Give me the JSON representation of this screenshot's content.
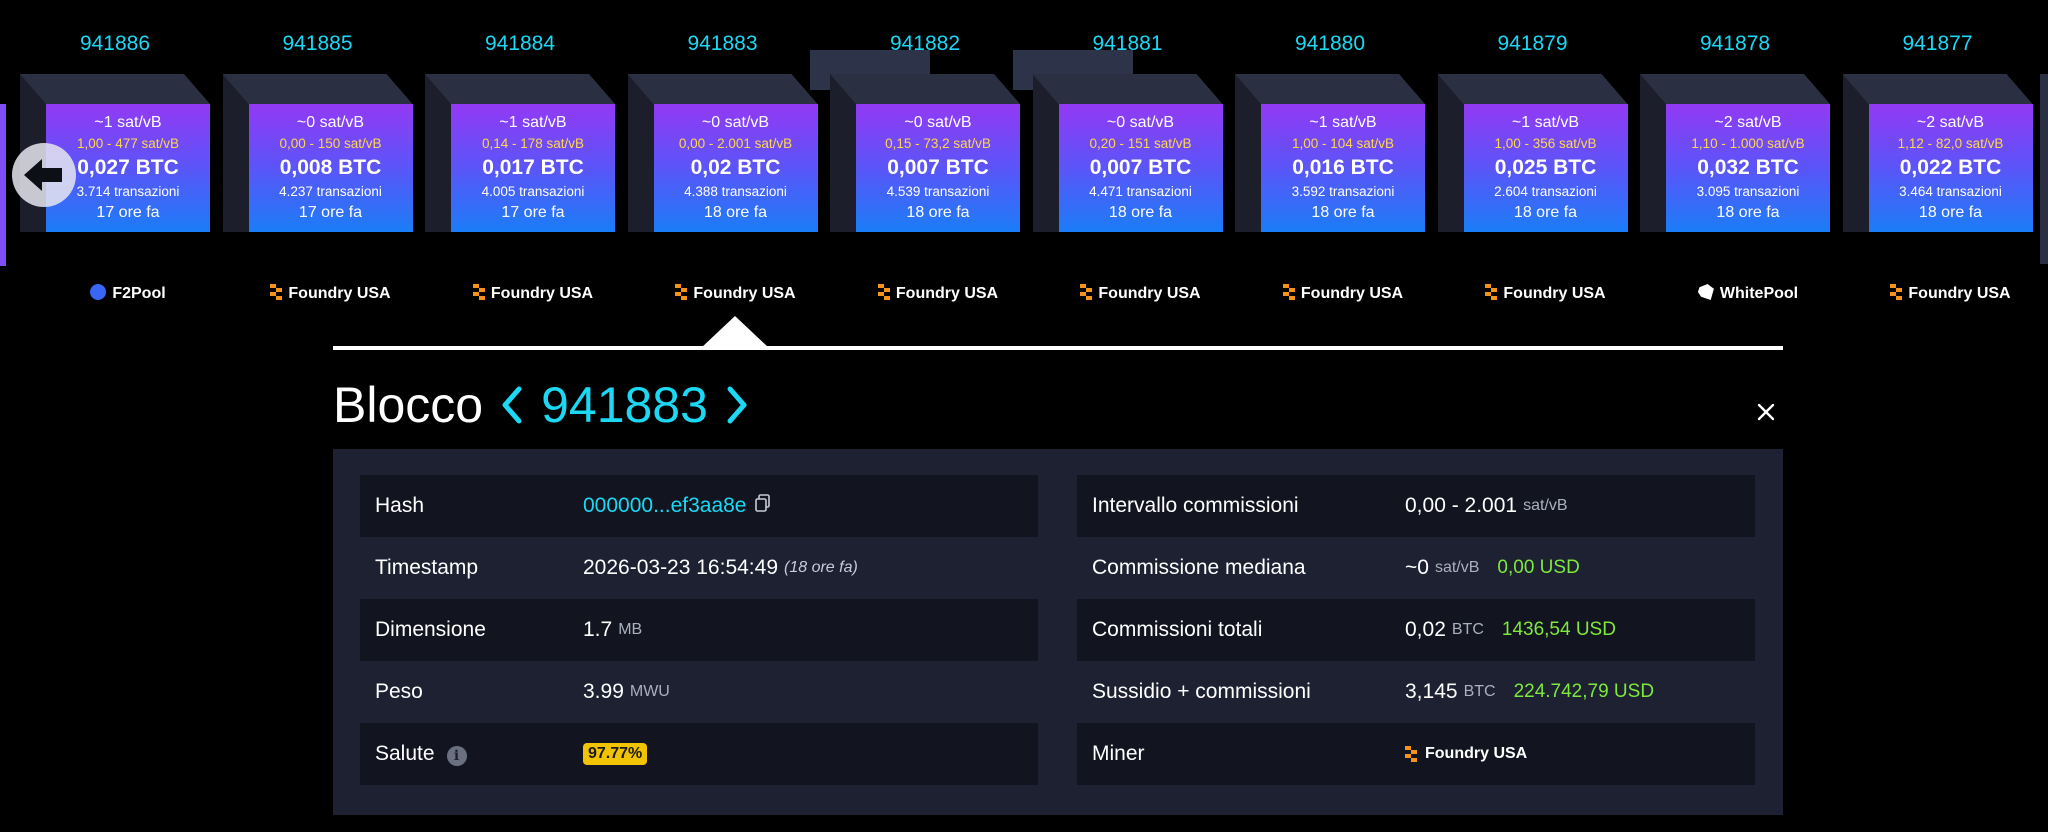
{
  "blocks": [
    {
      "height": "941886",
      "fee_median": "~1 sat/vB",
      "fee_range": "1,00 - 477 sat/vB",
      "btc": "0,027 BTC",
      "txs": "3.714 transazioni",
      "time": "17 ore fa",
      "pool": "F2Pool",
      "pool_icon": "f2pool-icon"
    },
    {
      "height": "941885",
      "fee_median": "~0 sat/vB",
      "fee_range": "0,00 - 150 sat/vB",
      "btc": "0,008 BTC",
      "txs": "4.237 transazioni",
      "time": "17 ore fa",
      "pool": "Foundry USA",
      "pool_icon": "foundry-icon"
    },
    {
      "height": "941884",
      "fee_median": "~1 sat/vB",
      "fee_range": "0,14 - 178 sat/vB",
      "btc": "0,017 BTC",
      "txs": "4.005 transazioni",
      "time": "17 ore fa",
      "pool": "Foundry USA",
      "pool_icon": "foundry-icon"
    },
    {
      "height": "941883",
      "fee_median": "~0 sat/vB",
      "fee_range": "0,00 - 2.001 sat/vB",
      "btc": "0,02 BTC",
      "txs": "4.388 transazioni",
      "time": "18 ore fa",
      "pool": "Foundry USA",
      "pool_icon": "foundry-icon"
    },
    {
      "height": "941882",
      "fee_median": "~0 sat/vB",
      "fee_range": "0,15 - 73,2 sat/vB",
      "btc": "0,007 BTC",
      "txs": "4.539 transazioni",
      "time": "18 ore fa",
      "pool": "Foundry USA",
      "pool_icon": "foundry-icon"
    },
    {
      "height": "941881",
      "fee_median": "~0 sat/vB",
      "fee_range": "0,20 - 151 sat/vB",
      "btc": "0,007 BTC",
      "txs": "4.471 transazioni",
      "time": "18 ore fa",
      "pool": "Foundry USA",
      "pool_icon": "foundry-icon"
    },
    {
      "height": "941880",
      "fee_median": "~1 sat/vB",
      "fee_range": "1,00 - 104 sat/vB",
      "btc": "0,016 BTC",
      "txs": "3.592 transazioni",
      "time": "18 ore fa",
      "pool": "Foundry USA",
      "pool_icon": "foundry-icon"
    },
    {
      "height": "941879",
      "fee_median": "~1 sat/vB",
      "fee_range": "1,00 - 356 sat/vB",
      "btc": "0,025 BTC",
      "txs": "2.604 transazioni",
      "time": "18 ore fa",
      "pool": "Foundry USA",
      "pool_icon": "foundry-icon"
    },
    {
      "height": "941878",
      "fee_median": "~2 sat/vB",
      "fee_range": "1,10 - 1.000 sat/vB",
      "btc": "0,032 BTC",
      "txs": "3.095 transazioni",
      "time": "18 ore fa",
      "pool": "WhitePool",
      "pool_icon": "whitepool-icon"
    },
    {
      "height": "941877",
      "fee_median": "~2 sat/vB",
      "fee_range": "1,12 - 82,0 sat/vB",
      "btc": "0,022 BTC",
      "txs": "3.464 transazioni",
      "time": "18 ore fa",
      "pool": "Foundry USA",
      "pool_icon": "foundry-icon"
    }
  ],
  "header": {
    "title": "Blocco",
    "height": "941883"
  },
  "details_left": {
    "hash_label": "Hash",
    "hash_value": "000000...ef3aa8e",
    "timestamp_label": "Timestamp",
    "timestamp_value": "2026-03-23 16:54:49",
    "timestamp_ago": "(18 ore fa)",
    "size_label": "Dimensione",
    "size_value": "1.7",
    "size_unit": "MB",
    "weight_label": "Peso",
    "weight_value": "3.99",
    "weight_unit": "MWU",
    "health_label": "Salute",
    "health_value": "97.77%"
  },
  "details_right": {
    "fee_span_label": "Intervallo commissioni",
    "fee_span_value": "0,00 - 2.001",
    "fee_span_unit": "sat/vB",
    "median_fee_label": "Commissione mediana",
    "median_fee_value": "~0",
    "median_fee_unit": "sat/vB",
    "median_fee_usd": "0,00 USD",
    "total_fees_label": "Commissioni totali",
    "total_fees_value": "0,02",
    "total_fees_unit": "BTC",
    "total_fees_usd": "1436,54 USD",
    "subsidy_label": "Sussidio + commissioni",
    "subsidy_value": "3,145",
    "subsidy_unit": "BTC",
    "subsidy_usd": "224.742,79 USD",
    "miner_label": "Miner",
    "miner_value": "Foundry USA"
  },
  "colors": {
    "accent": "#1bd8f4",
    "usd": "#7ee83c",
    "fee_range": "#ffd84d",
    "badge": "#f2c400"
  }
}
